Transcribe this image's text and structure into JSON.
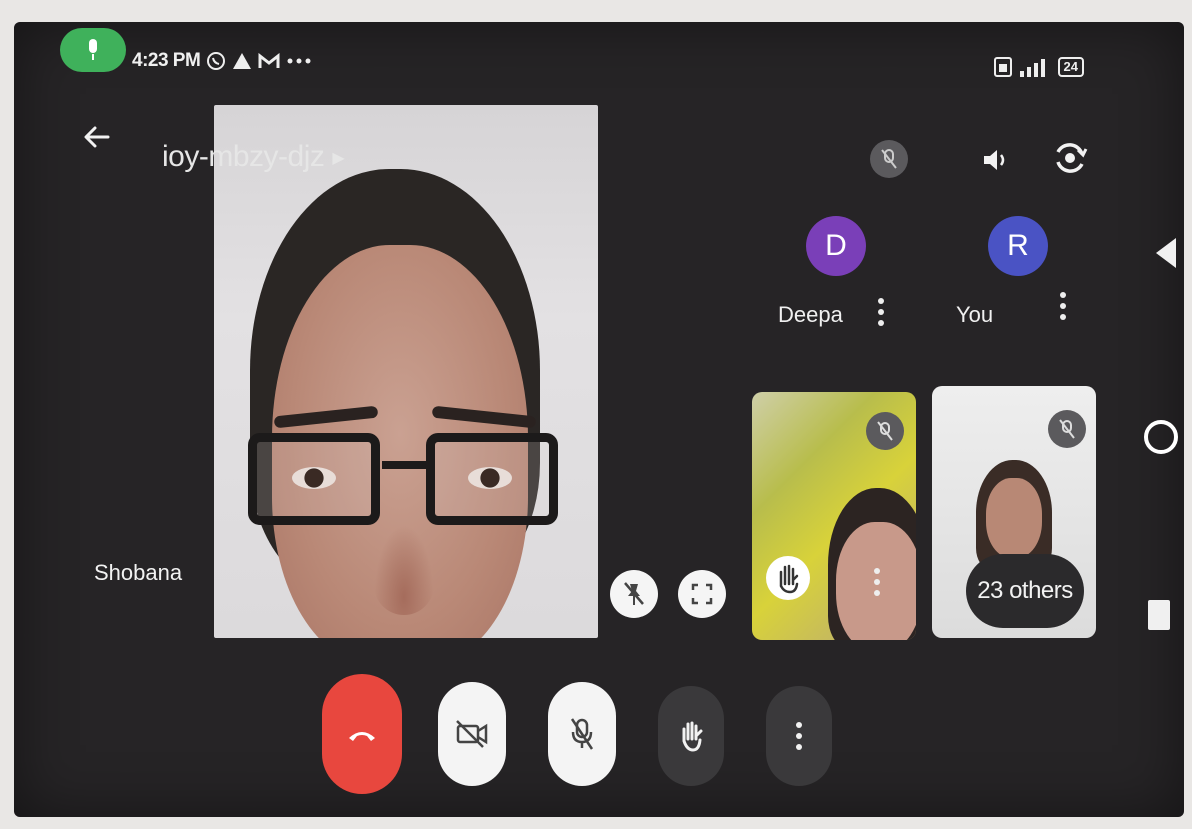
{
  "status_bar": {
    "time": "4:23 PM",
    "battery": "24"
  },
  "meeting": {
    "code": "ioy-mbzy-djz"
  },
  "main_tile": {
    "name": "Shobana"
  },
  "participants": [
    {
      "initial": "D",
      "name": "Deepa",
      "color": "#7a3fb8"
    },
    {
      "initial": "R",
      "name": "You",
      "color": "#4a53c4"
    }
  ],
  "others": {
    "label": "23 others"
  },
  "colors": {
    "end_call": "#e8473e",
    "control_light": "#f4f4f4",
    "control_dark": "#3a393b",
    "status_green": "#3fb15b"
  }
}
